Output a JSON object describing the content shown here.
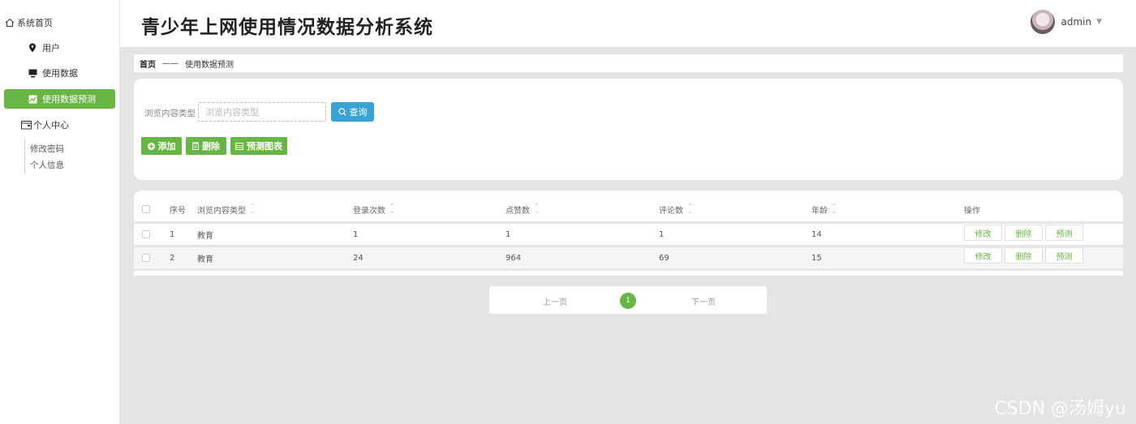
{
  "app": {
    "title": "青少年上网使用情况数据分析系统"
  },
  "user": {
    "name": "admin"
  },
  "sidebar": {
    "items": [
      {
        "label": "系统首页"
      },
      {
        "label": "用户"
      },
      {
        "label": "使用数据"
      },
      {
        "label": "使用数据预测"
      },
      {
        "label": "个人中心"
      }
    ],
    "sub_items": [
      {
        "label": "修改密码"
      },
      {
        "label": "个人信息"
      }
    ]
  },
  "breadcrumb": {
    "home": "首页",
    "separator": "——",
    "current": "使用数据预测"
  },
  "search": {
    "label": "浏览内容类型",
    "placeholder": "浏览内容类型",
    "button_label": "查询"
  },
  "actions": {
    "add": "添加",
    "delete": "删除",
    "chart": "预测图表"
  },
  "table": {
    "headers": [
      "序号",
      "浏览内容类型",
      "登录次数",
      "点赞数",
      "评论数",
      "年龄",
      "操作"
    ],
    "rows": [
      {
        "index": "1",
        "type": "教育",
        "logins": "1",
        "likes": "1",
        "comments": "1",
        "age": "14"
      },
      {
        "index": "2",
        "type": "教育",
        "logins": "24",
        "likes": "964",
        "comments": "69",
        "age": "15"
      }
    ],
    "ops": {
      "edit": "修改",
      "delete": "删除",
      "predict": "预测"
    }
  },
  "pagination": {
    "prev": "上一页",
    "current": "1",
    "next": "下一页"
  },
  "watermark": "CSDN @汤姆yu",
  "colors": {
    "accent": "#67b544",
    "query": "#3aa3d6",
    "background": "#e4e4e4"
  }
}
